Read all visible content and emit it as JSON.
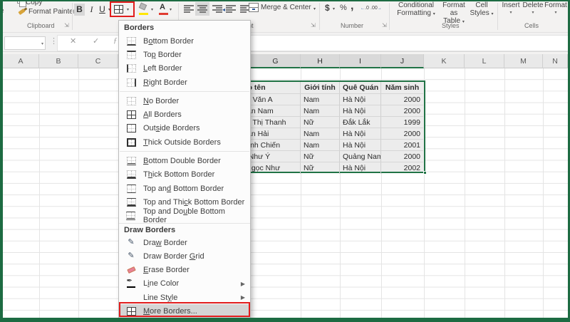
{
  "ribbon": {
    "clipboard": {
      "copy_label": "Copy",
      "format_painter_label": "Format Painter",
      "group_label": "Clipboard",
      "paste_fragment": "e"
    },
    "font": {
      "bold": "B",
      "italic": "I",
      "underline": "U",
      "group_label_partial": "F"
    },
    "alignment": {
      "merge_label": "Merge & Center",
      "group_label_partial": "nt"
    },
    "number": {
      "currency": "$",
      "percent": "%",
      "comma": ",",
      "inc_dec": ".0",
      "dec_dec": ".00",
      "group_label": "Number"
    },
    "styles": {
      "buttons": [
        {
          "line1": "Conditional",
          "line2": "Formatting"
        },
        {
          "line1": "Format as",
          "line2": "Table"
        },
        {
          "line1": "Cell",
          "line2": "Styles"
        }
      ],
      "group_label": "Styles"
    },
    "cells": {
      "buttons": [
        "Insert",
        "Delete",
        "Format"
      ],
      "group_label": "Cells"
    }
  },
  "formula_bar": {
    "cancel": "✕",
    "enter": "✓",
    "fx": "ƒ",
    "name_box_value": ""
  },
  "menu": {
    "title": "Borders",
    "entries": [
      {
        "type": "item",
        "label": "Bottom Border",
        "u": 1,
        "border": "bottom",
        "icon": "border-bottom-icon"
      },
      {
        "type": "item",
        "label": "Top Border",
        "u": 2,
        "border": "top",
        "icon": "border-top-icon"
      },
      {
        "type": "item",
        "label": "Left Border",
        "u": 0,
        "border": "left",
        "icon": "border-left-icon"
      },
      {
        "type": "item",
        "label": "Right Border",
        "u": 0,
        "border": "right",
        "icon": "border-right-icon"
      },
      {
        "type": "sep"
      },
      {
        "type": "item",
        "label": "No Border",
        "u": 0,
        "border": "none",
        "icon": "border-none-icon"
      },
      {
        "type": "item",
        "label": "All Borders",
        "u": 0,
        "border": "all",
        "icon": "border-all-icon"
      },
      {
        "type": "item",
        "label": "Outside Borders",
        "u": 3,
        "border": "outside",
        "icon": "border-outside-icon"
      },
      {
        "type": "item",
        "label": "Thick Outside Borders",
        "u": 0,
        "border": "thick-outside",
        "icon": "border-thick-outside-icon"
      },
      {
        "type": "sep"
      },
      {
        "type": "item",
        "label": "Bottom Double Border",
        "u": 0,
        "border": "double-bottom",
        "icon": "border-bottom-double-icon"
      },
      {
        "type": "item",
        "label": "Thick Bottom Border",
        "u": 1,
        "border": "thick-bottom",
        "icon": "border-thick-bottom-icon"
      },
      {
        "type": "item",
        "label": "Top and Bottom Border",
        "u": 6,
        "border": "top-bottom",
        "icon": "border-top-bottom-icon"
      },
      {
        "type": "item",
        "label": "Top and Thick Bottom Border",
        "u": 11,
        "border": "top-thick-bottom",
        "icon": "border-top-thick-bottom-icon"
      },
      {
        "type": "item",
        "label": "Top and Double Bottom Border",
        "u": 10,
        "border": "top-double-bottom",
        "icon": "border-top-double-bottom-icon"
      },
      {
        "type": "header",
        "label": "Draw Borders"
      },
      {
        "type": "item",
        "label": "Draw Border",
        "u": 3,
        "icon": "pencil-icon"
      },
      {
        "type": "item",
        "label": "Draw Border Grid",
        "u": 12,
        "icon": "pencil-grid-icon"
      },
      {
        "type": "item",
        "label": "Erase Border",
        "u": 0,
        "icon": "eraser-icon"
      },
      {
        "type": "item",
        "label": "Line Color",
        "u": 1,
        "icon": "pen-color-icon",
        "submenu": true
      },
      {
        "type": "item",
        "label": "Line Style",
        "u": 7,
        "submenu": true
      },
      {
        "type": "item",
        "label": "More Borders...",
        "u": 0,
        "border": "all",
        "icon": "more-borders-icon",
        "highlight": true
      }
    ]
  },
  "sheet": {
    "columns_left": [
      "A",
      "B",
      "C"
    ],
    "columns_right": [
      "G",
      "H",
      "I",
      "J",
      "K",
      "L",
      "M",
      "N"
    ],
    "selected_columns": [
      "G",
      "H",
      "I",
      "J"
    ],
    "table": {
      "headers": [
        "Họ tên",
        "Giới tính",
        "Quê Quán",
        "Năm sinh"
      ],
      "rows": [
        [
          "ễn Văn A",
          "Nam",
          "Hà Nội",
          "2000"
        ],
        [
          "Văn Nam",
          "Nam",
          "Hà Nội",
          "2000"
        ],
        [
          "ễn Thị Thanh",
          "Nữ",
          "Đắk Lắk",
          "1999"
        ],
        [
          "Văn Hải",
          "Nam",
          "Hà Nội",
          "2000"
        ],
        [
          "Minh Chiến",
          "Nam",
          "Hà Nội",
          "2001"
        ],
        [
          "n Như Ý",
          "Nữ",
          "Quảng Nam",
          "2000"
        ],
        [
          "ị Ngọc Như",
          "Nữ",
          "Hà Nội",
          "2002"
        ]
      ]
    }
  },
  "colors": {
    "excel_green": "#1d6b42",
    "selection_green": "#217346",
    "highlight_red": "#e11d1d"
  }
}
